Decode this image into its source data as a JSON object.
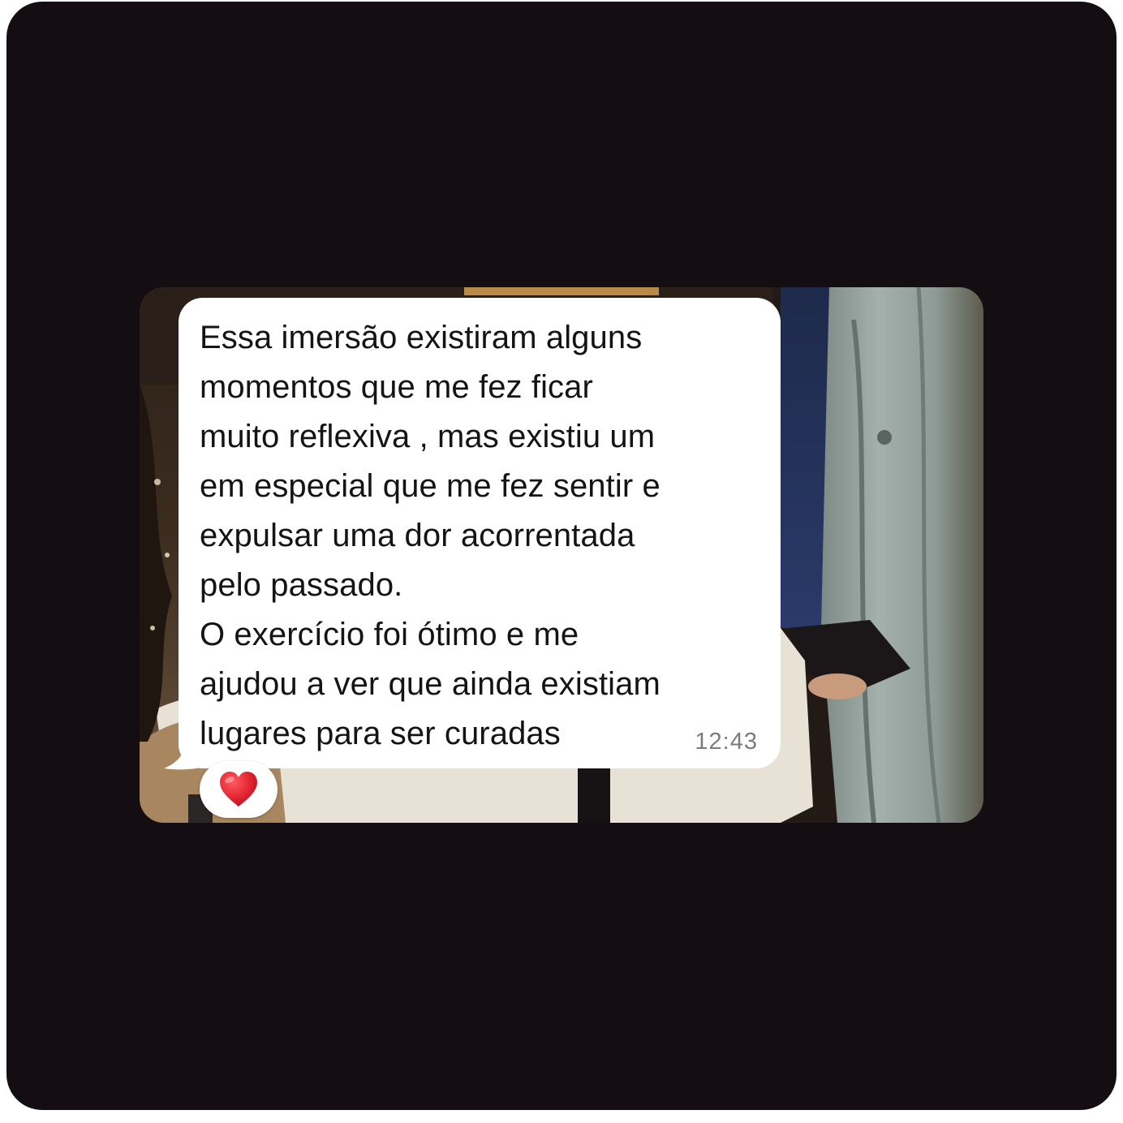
{
  "chat": {
    "message": {
      "text": "Essa imersão existiram alguns\nmomentos que me fez ficar\nmuito reflexiva , mas existiu um\nem especial  que me fez sentir e\nexpulsar uma dor acorrentada\npelo passado.\nO exercício foi ótimo e me\najudou a ver que ainda existiam\nlugares para ser curadas",
      "time": "12:43"
    },
    "reaction": {
      "icon": "red-heart-icon"
    }
  },
  "colors": {
    "page_background": "#140e12",
    "bubble": "#ffffff",
    "text": "#141414",
    "timestamp": "#7c7c7c",
    "heart": "#e0242f"
  }
}
